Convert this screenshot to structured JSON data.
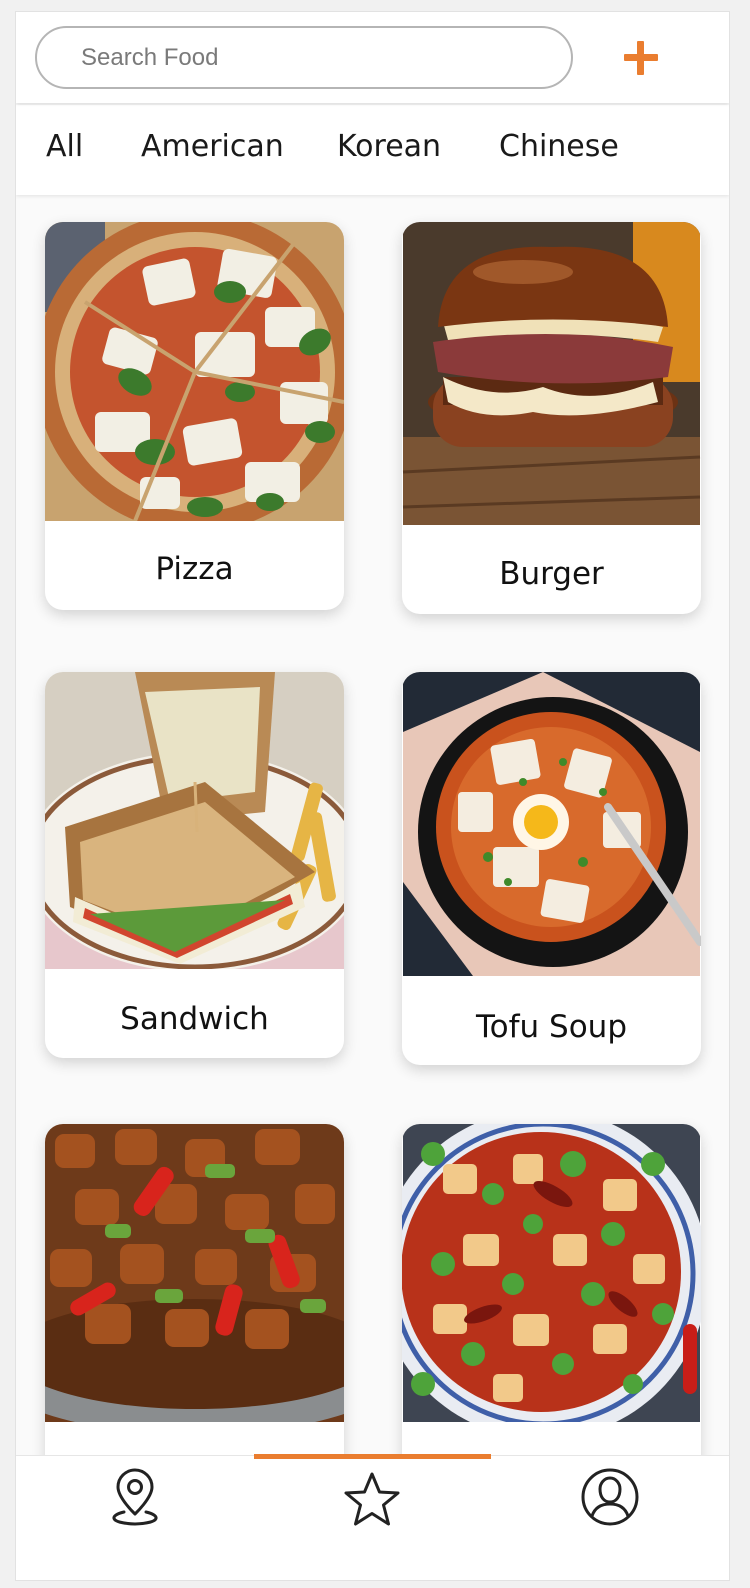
{
  "search": {
    "placeholder": "Search Food",
    "value": ""
  },
  "add_button": {
    "icon": "plus-icon"
  },
  "colors": {
    "accent": "#ea7d2f"
  },
  "categories": [
    "All",
    "American",
    "Korean",
    "Chinese"
  ],
  "foods": [
    {
      "label": "Pizza",
      "image": "pizza"
    },
    {
      "label": "Burger",
      "image": "burger"
    },
    {
      "label": "Sandwich",
      "image": "sandwich"
    },
    {
      "label": "Tofu Soup",
      "image": "tofu-soup"
    },
    {
      "label": "",
      "image": "kung-pao-chicken"
    },
    {
      "label": "",
      "image": "mapo-tofu"
    }
  ],
  "bottom_nav": {
    "items": [
      {
        "icon": "location-pin-icon"
      },
      {
        "icon": "star-icon"
      },
      {
        "icon": "profile-icon"
      }
    ],
    "active": 1
  }
}
